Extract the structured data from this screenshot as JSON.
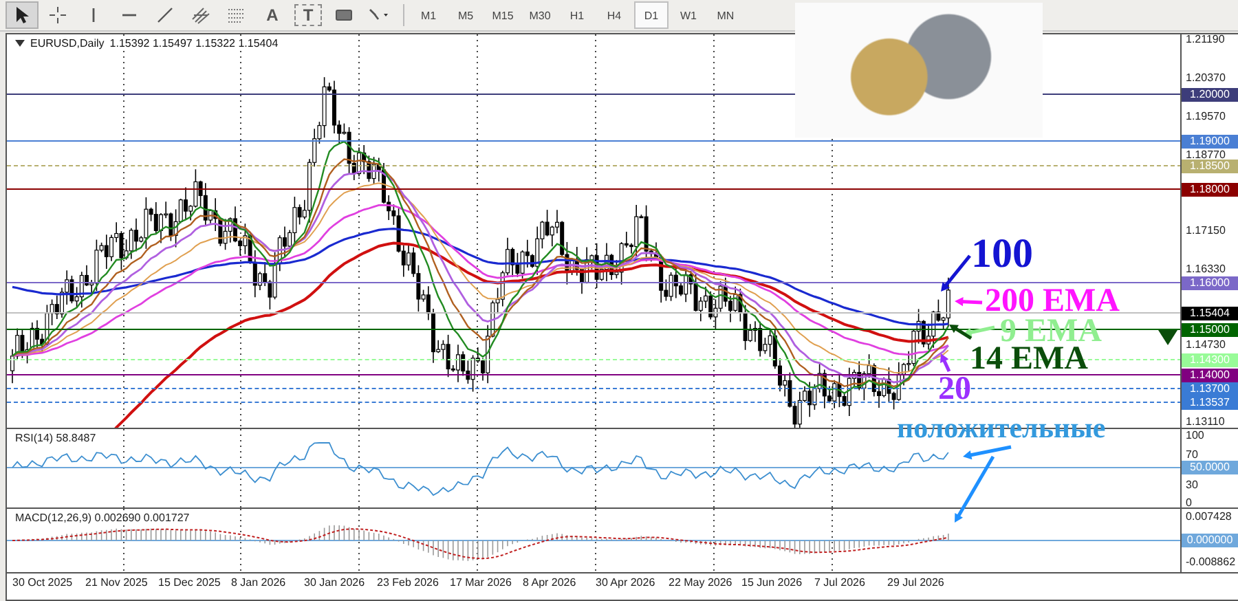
{
  "toolbar": {
    "tools": [
      {
        "kind": "cursor",
        "selected": true
      },
      {
        "kind": "crosshair",
        "selected": false
      },
      {
        "kind": "vline",
        "selected": false
      },
      {
        "kind": "hline",
        "selected": false
      },
      {
        "kind": "trendline",
        "selected": false
      },
      {
        "kind": "fibo",
        "selected": false
      },
      {
        "kind": "grid",
        "selected": false
      },
      {
        "kind": "text",
        "label": "A",
        "selected": false
      },
      {
        "kind": "textlabel",
        "label": "T",
        "selected": false
      },
      {
        "kind": "rectangle",
        "selected": false
      },
      {
        "kind": "arrows",
        "selected": false
      }
    ],
    "timeframes": [
      {
        "label": "M1",
        "selected": false
      },
      {
        "label": "M5",
        "selected": false
      },
      {
        "label": "M15",
        "selected": false
      },
      {
        "label": "M30",
        "selected": false
      },
      {
        "label": "H1",
        "selected": false
      },
      {
        "label": "H4",
        "selected": false
      },
      {
        "label": "D1",
        "selected": true
      },
      {
        "label": "W1",
        "selected": false
      },
      {
        "label": "MN",
        "selected": false
      }
    ]
  },
  "chart": {
    "symbol": "EURUSD,Daily",
    "ohlc": "1.15392 1.15497 1.15322 1.15404",
    "price_ticks": [
      "1.21190",
      "1.20370",
      "1.19570",
      "1.18770",
      "1.17150",
      "1.16330",
      "1.14730",
      "1.13110"
    ],
    "levels": [
      {
        "value": "1.20000",
        "color": "#3d3d7a",
        "dashed": false
      },
      {
        "value": "1.19000",
        "color": "#4a7fd4",
        "dashed": false
      },
      {
        "value": "1.18500",
        "color": "#b8b070",
        "dashed": true
      },
      {
        "value": "1.18000",
        "color": "#8b0000",
        "dashed": false
      },
      {
        "value": "1.16000",
        "color": "#7b68c8",
        "dashed": false
      },
      {
        "value": "1.15404",
        "color": "#000000",
        "dashed": false
      },
      {
        "value": "1.15000",
        "color": "#006400",
        "dashed": false
      },
      {
        "value": "1.14300",
        "color": "#98fb98",
        "dashed": true
      },
      {
        "value": "1.14000",
        "color": "#800080",
        "dashed": false
      },
      {
        "value": "1.13700",
        "color": "#3a7bd5",
        "dashed": true
      },
      {
        "value": "1.13537",
        "color": "#3a7bd5",
        "dashed": true
      }
    ],
    "annotations": [
      {
        "text": "100",
        "color": "#1414d2"
      },
      {
        "text": "200 EMA",
        "color": "#ff14ff"
      },
      {
        "text": "9 EMA",
        "color": "#90ee90"
      },
      {
        "text": "14 EMA",
        "color": "#0b4d0b"
      },
      {
        "text": "20",
        "color": "#9b30ff"
      }
    ],
    "note": "положительные"
  },
  "rsi": {
    "label": "RSI(14) 58.8487",
    "ticks": [
      "100",
      "70",
      "30",
      "0"
    ],
    "level_tag": "50.0000"
  },
  "macd": {
    "label": "MACD(12,26,9) 0.002690 0.001727",
    "ticks": [
      "0.007428",
      "-0.008862"
    ],
    "level_tag": "0.000000"
  },
  "dates": [
    "30 Oct 2025",
    "21 Nov 2025",
    "15 Dec 2025",
    "8 Jan 2026",
    "30 Jan 2026",
    "23 Feb 2026",
    "17 Mar 2026",
    "8 Apr 2026",
    "30 Apr 2026",
    "22 May 2026",
    "15 Jun 2026",
    "7 Jul 2026",
    "29 Jul 2026"
  ]
}
